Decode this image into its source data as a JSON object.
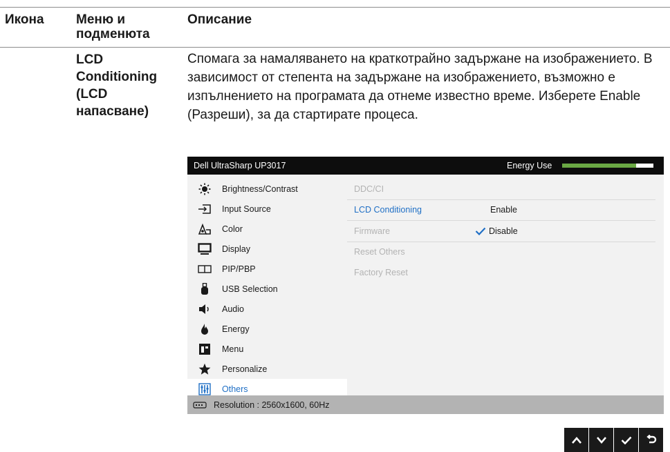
{
  "table": {
    "col_icon": "Икона",
    "col_menu": "Меню и подменюта",
    "col_desc": "Описание",
    "menu_name": "LCD Conditioning (LCD напасване)",
    "description": "Спомага за намаляването на краткотрайно задържане на изображението. В зависимост от степента на задържане на изображението, възможно е изпълнението на програмата да отнеме известно време. Изберете Enable (Разреши), за да стартирате процеса."
  },
  "osd": {
    "title": "Dell UltraSharp UP3017",
    "energy_label": "Energy Use",
    "energy_level": 0.81,
    "colors": {
      "accent": "#1f6fc5",
      "energy": "#6aa844"
    },
    "menu": [
      {
        "label": "Brightness/Contrast",
        "icon": "brightness-icon"
      },
      {
        "label": "Input Source",
        "icon": "input-source-icon"
      },
      {
        "label": "Color",
        "icon": "color-icon"
      },
      {
        "label": "Display",
        "icon": "display-icon"
      },
      {
        "label": "PIP/PBP",
        "icon": "pip-icon"
      },
      {
        "label": "USB Selection",
        "icon": "usb-icon"
      },
      {
        "label": "Audio",
        "icon": "audio-icon"
      },
      {
        "label": "Energy",
        "icon": "energy-icon"
      },
      {
        "label": "Menu",
        "icon": "menu-icon"
      },
      {
        "label": "Personalize",
        "icon": "star-icon"
      },
      {
        "label": "Others",
        "icon": "others-icon",
        "active": true
      }
    ],
    "submenu": [
      {
        "label": "DDC/CI",
        "value": ""
      },
      {
        "label": "LCD Conditioning",
        "value": "Enable"
      },
      {
        "label": "Firmware",
        "value": "Disable"
      },
      {
        "label": "Reset Others",
        "value": ""
      },
      {
        "label": "Factory Reset",
        "value": ""
      }
    ],
    "status": "Resolution : 2560x1600, 60Hz"
  },
  "nav_buttons": [
    "up-arrow-icon",
    "down-arrow-icon",
    "check-icon",
    "back-icon"
  ]
}
